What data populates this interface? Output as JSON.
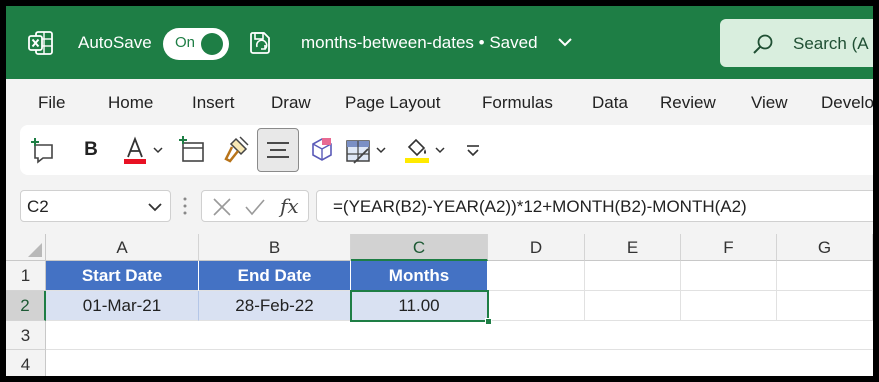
{
  "titlebar": {
    "autosave_label": "AutoSave",
    "autosave_state": "On",
    "document_title": "months-between-dates • Saved",
    "search_placeholder": "Search (A",
    "accent_color": "#1e7e45"
  },
  "tabs": [
    {
      "label": "File"
    },
    {
      "label": "Home"
    },
    {
      "label": "Insert"
    },
    {
      "label": "Draw"
    },
    {
      "label": "Page Layout"
    },
    {
      "label": "Formulas"
    },
    {
      "label": "Data"
    },
    {
      "label": "Review"
    },
    {
      "label": "View"
    },
    {
      "label": "Develo"
    }
  ],
  "ribbon": {
    "bold_label": "B",
    "icons": [
      "new-comment-icon",
      "bold-icon",
      "font-color-icon",
      "insert-table-icon",
      "format-painter-icon",
      "align-center-icon",
      "cube-icon",
      "format-table-icon",
      "fill-color-icon",
      "more-options-icon"
    ],
    "font_color": "#e81123",
    "fill_color": "#ffea00"
  },
  "formula_bar": {
    "name_box": "C2",
    "fx_label": "fx",
    "formula": "=(YEAR(B2)-YEAR(A2))*12+MONTH(B2)-MONTH(A2)"
  },
  "sheet": {
    "columns": [
      "A",
      "B",
      "C",
      "D",
      "E",
      "F",
      "G"
    ],
    "rows": [
      "1",
      "2",
      "3",
      "4"
    ],
    "selected_cell": "C2",
    "header_fill": "#4472c4",
    "data_fill": "#d9e1f2",
    "table": {
      "headers": [
        "Start Date",
        "End Date",
        "Months"
      ],
      "row": [
        "01-Mar-21",
        "28-Feb-22",
        "11.00"
      ]
    }
  }
}
